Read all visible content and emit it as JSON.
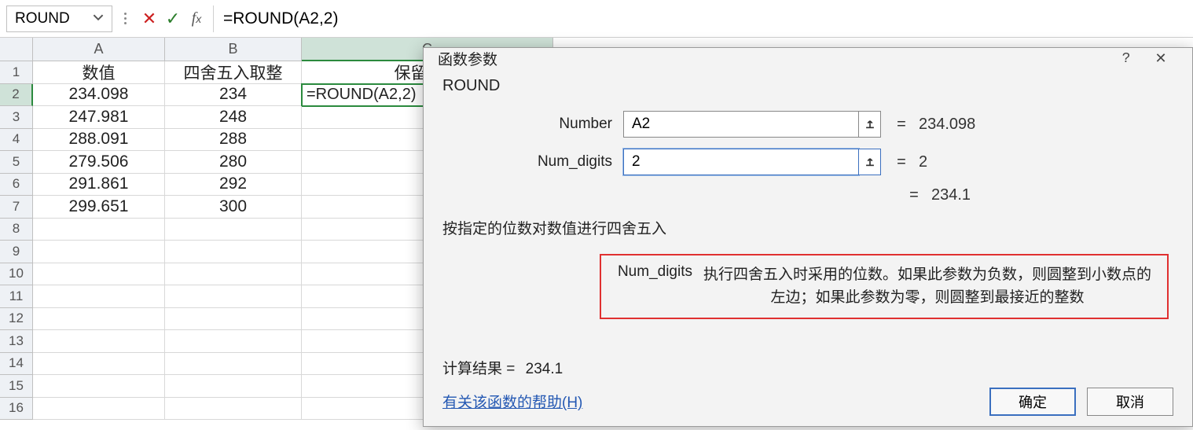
{
  "formula_bar": {
    "name_box": "ROUND",
    "formula": "=ROUND(A2,2)"
  },
  "columns": [
    "A",
    "B",
    "C"
  ],
  "headers": {
    "A": "数值",
    "B": "四舍五入取整",
    "C": "保留两位"
  },
  "rows": [
    {
      "n": "1"
    },
    {
      "n": "2",
      "A": "234.098",
      "B": "234",
      "C": "=ROUND(A2,2)"
    },
    {
      "n": "3",
      "A": "247.981",
      "B": "248"
    },
    {
      "n": "4",
      "A": "288.091",
      "B": "288"
    },
    {
      "n": "5",
      "A": "279.506",
      "B": "280"
    },
    {
      "n": "6",
      "A": "291.861",
      "B": "292"
    },
    {
      "n": "7",
      "A": "299.651",
      "B": "300"
    },
    {
      "n": "8"
    },
    {
      "n": "9"
    },
    {
      "n": "10"
    },
    {
      "n": "11"
    },
    {
      "n": "12"
    },
    {
      "n": "13"
    },
    {
      "n": "14"
    },
    {
      "n": "15"
    },
    {
      "n": "16"
    }
  ],
  "dialog": {
    "title": "函数参数",
    "help_btn": "?",
    "close_btn": "✕",
    "func_name": "ROUND",
    "args": {
      "number": {
        "label": "Number",
        "value": "A2",
        "eval": "234.098"
      },
      "num_digits": {
        "label": "Num_digits",
        "value": "2",
        "eval": "2"
      }
    },
    "preview_equals": "=",
    "preview_value": "234.1",
    "description": "按指定的位数对数值进行四舍五入",
    "hint": {
      "param": "Num_digits",
      "text": "执行四舍五入时采用的位数。如果此参数为负数，则圆整到小数点的左边；如果此参数为零，则圆整到最接近的整数"
    },
    "result_label": "计算结果 =",
    "result_value": "234.1",
    "help_link": "有关该函数的帮助(H)",
    "ok": "确定",
    "cancel": "取消"
  }
}
